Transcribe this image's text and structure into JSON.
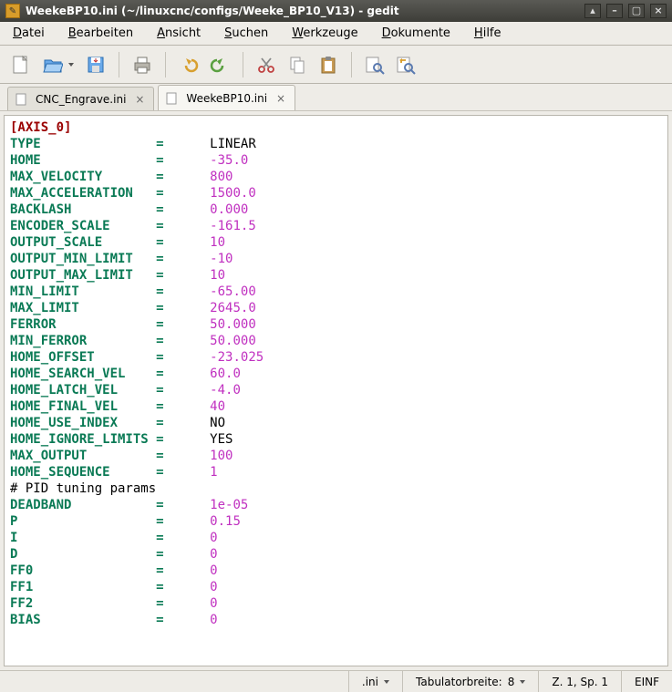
{
  "window": {
    "title": "WeekeBP10.ini (~/linuxcnc/configs/Weeke_BP10_V13) - gedit"
  },
  "menu": {
    "file": "Datei",
    "edit": "Bearbeiten",
    "view": "Ansicht",
    "search": "Suchen",
    "tools": "Werkzeuge",
    "documents": "Dokumente",
    "help": "Hilfe"
  },
  "tabs": [
    {
      "label": "CNC_Engrave.ini",
      "active": false
    },
    {
      "label": "WeekeBP10.ini",
      "active": true
    }
  ],
  "status": {
    "lang": ".ini",
    "tabwidth_label": "Tabulatorbreite:",
    "tabwidth_value": "8",
    "pos": "Z. 1, Sp. 1",
    "insmode": "EINF"
  },
  "ini": {
    "section": "[AXIS_0]",
    "comment": "# PID tuning params",
    "rows": [
      {
        "k": "TYPE",
        "v": "LINEAR",
        "t": "str"
      },
      {
        "k": "HOME",
        "v": "-35.0",
        "t": "num"
      },
      {
        "k": "MAX_VELOCITY",
        "v": "800",
        "t": "num"
      },
      {
        "k": "MAX_ACCELERATION",
        "v": "1500.0",
        "t": "num"
      },
      {
        "k": "BACKLASH",
        "v": "0.000",
        "t": "num"
      },
      {
        "k": "ENCODER_SCALE",
        "v": "-161.5",
        "t": "num"
      },
      {
        "k": "OUTPUT_SCALE",
        "v": "10",
        "t": "num"
      },
      {
        "k": "OUTPUT_MIN_LIMIT",
        "v": "-10",
        "t": "num"
      },
      {
        "k": "OUTPUT_MAX_LIMIT",
        "v": "10",
        "t": "num"
      },
      {
        "k": "MIN_LIMIT",
        "v": "-65.00",
        "t": "num"
      },
      {
        "k": "MAX_LIMIT",
        "v": "2645.0",
        "t": "num"
      },
      {
        "k": "FERROR",
        "v": "50.000",
        "t": "num"
      },
      {
        "k": "MIN_FERROR",
        "v": "50.000",
        "t": "num"
      },
      {
        "k": "HOME_OFFSET",
        "v": "-23.025",
        "t": "num"
      },
      {
        "k": "HOME_SEARCH_VEL",
        "v": "60.0",
        "t": "num"
      },
      {
        "k": "HOME_LATCH_VEL",
        "v": "-4.0",
        "t": "num"
      },
      {
        "k": "HOME_FINAL_VEL",
        "v": "40",
        "t": "num"
      },
      {
        "k": "HOME_USE_INDEX",
        "v": "NO",
        "t": "str"
      },
      {
        "k": "HOME_IGNORE_LIMITS",
        "v": "YES",
        "t": "str"
      },
      {
        "k": "MAX_OUTPUT",
        "v": "100",
        "t": "num"
      },
      {
        "k": "HOME_SEQUENCE",
        "v": "1",
        "t": "num"
      }
    ],
    "pid_rows": [
      {
        "k": "DEADBAND",
        "v": "1e-05",
        "t": "num"
      },
      {
        "k": "P",
        "v": "0.15",
        "t": "num"
      },
      {
        "k": "I",
        "v": "0",
        "t": "num"
      },
      {
        "k": "D",
        "v": "0",
        "t": "num"
      },
      {
        "k": "FF0",
        "v": "0",
        "t": "num"
      },
      {
        "k": "FF1",
        "v": "0",
        "t": "num"
      },
      {
        "k": "FF2",
        "v": "0",
        "t": "num"
      },
      {
        "k": "BIAS",
        "v": "0",
        "t": "num"
      }
    ]
  }
}
